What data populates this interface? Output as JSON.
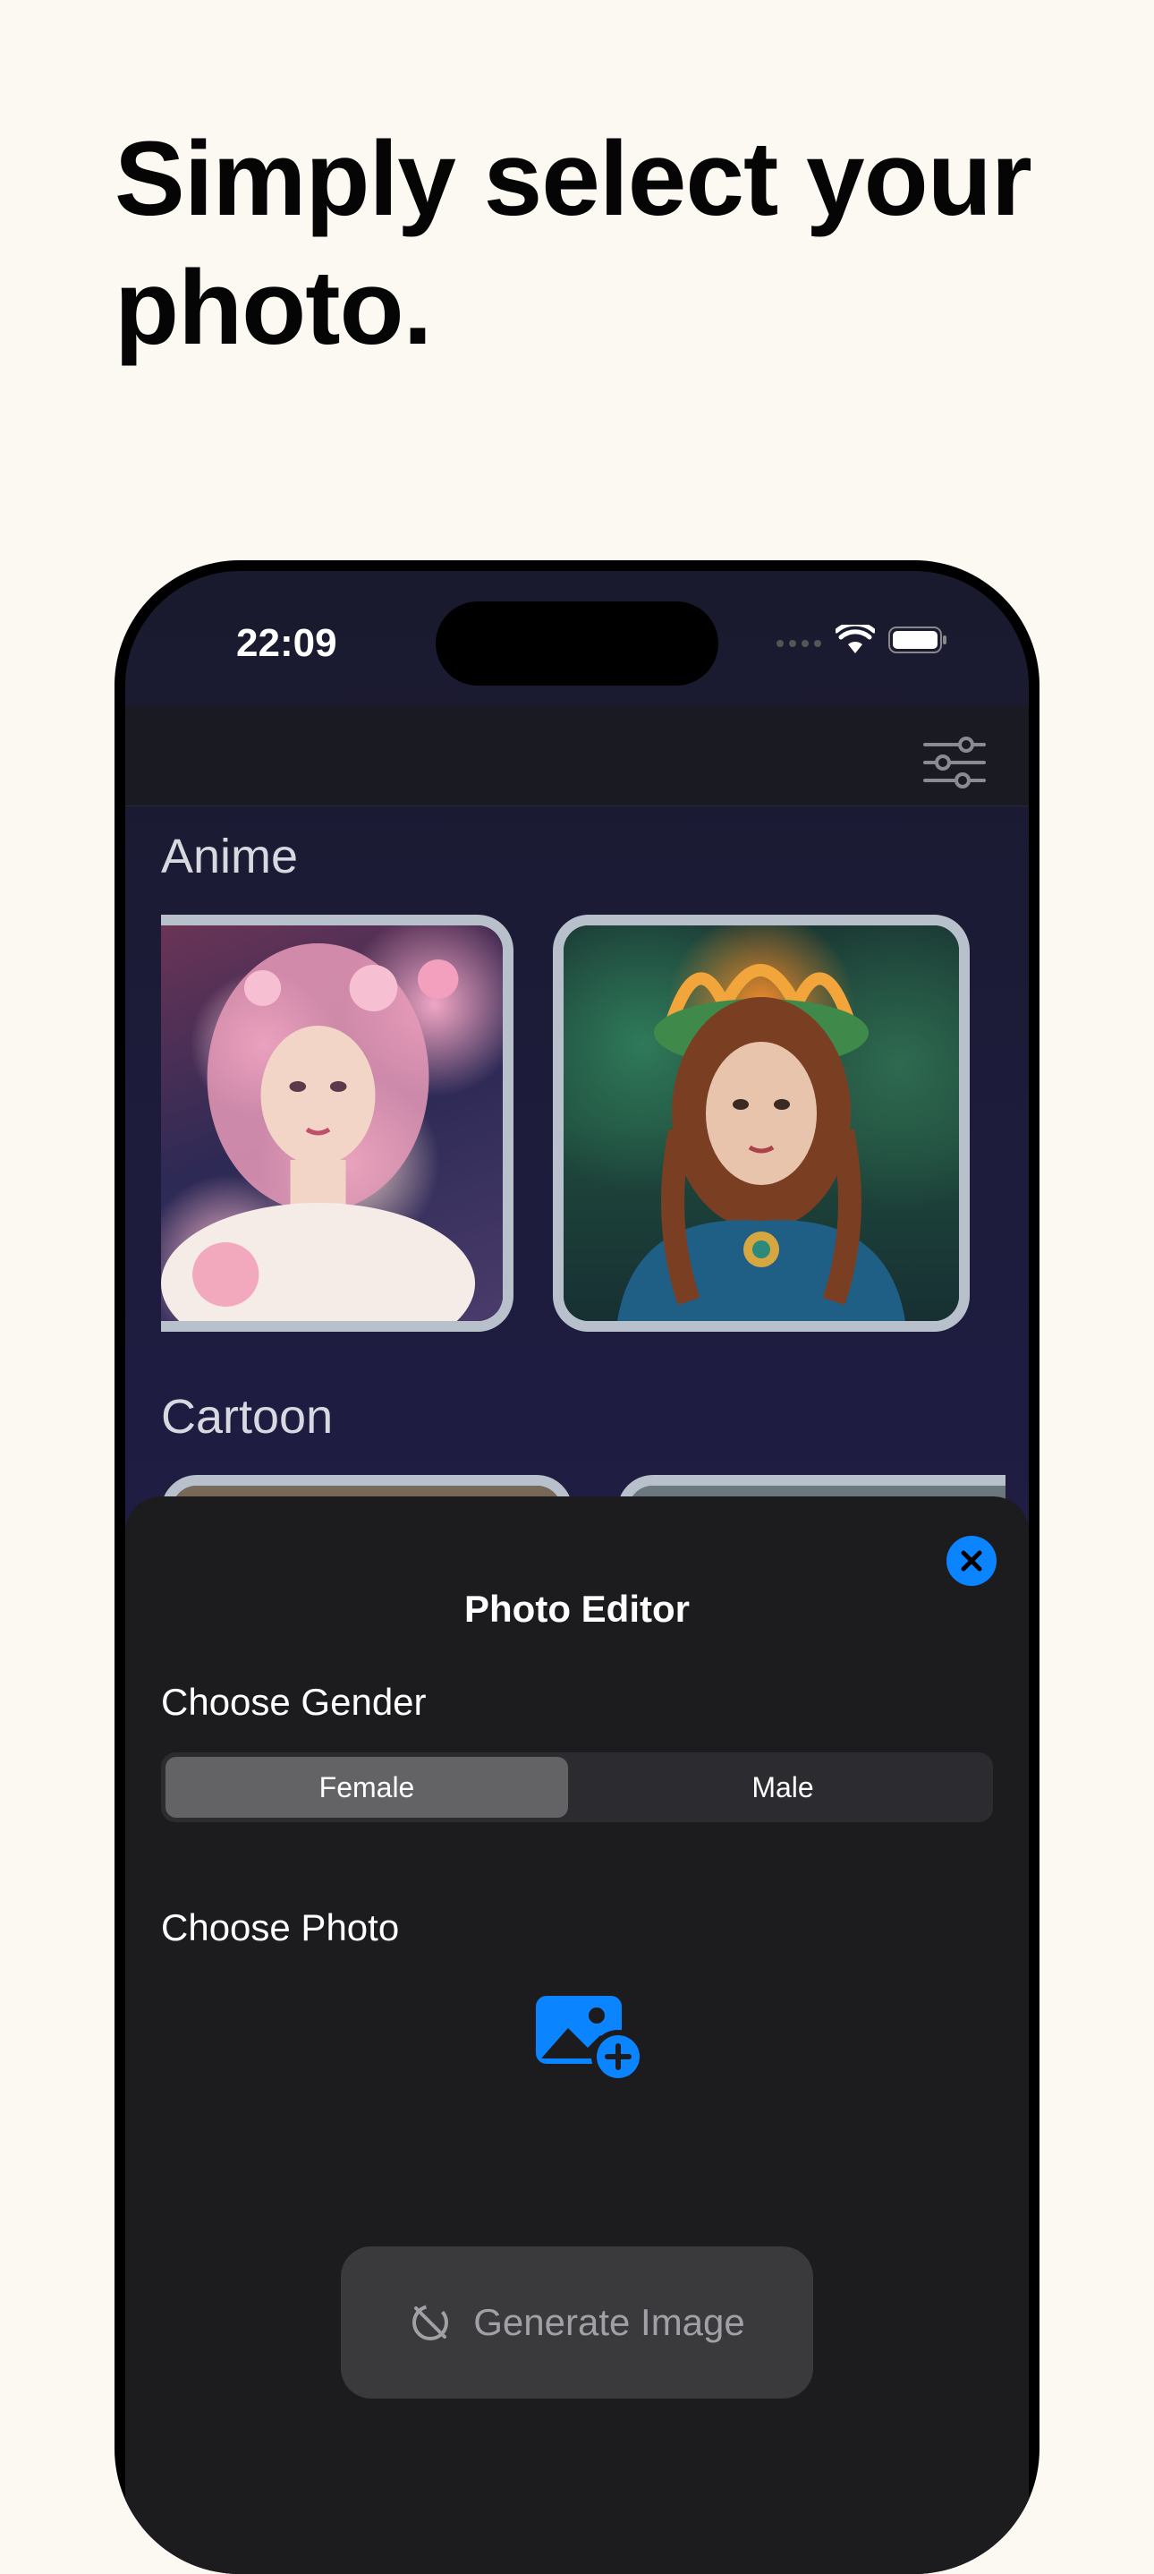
{
  "headline": "Simply select your photo.",
  "status_bar": {
    "time": "22:09"
  },
  "gallery": {
    "sections": [
      {
        "title": "Anime"
      },
      {
        "title": "Cartoon"
      }
    ]
  },
  "sheet": {
    "title": "Photo Editor",
    "gender_label": "Choose  Gender",
    "gender_options": [
      "Female",
      "Male"
    ],
    "gender_selected": "Female",
    "photo_label": "Choose  Photo",
    "generate_label": "Generate Image"
  },
  "icons": {
    "filter": "sliders-icon",
    "close": "close-icon",
    "add_photo": "photo-add-icon",
    "generate": "disabled-sparkle-icon"
  },
  "colors": {
    "accent": "#0a84ff",
    "page_background": "#fcf8f2",
    "sheet_background": "#1c1c1e"
  }
}
